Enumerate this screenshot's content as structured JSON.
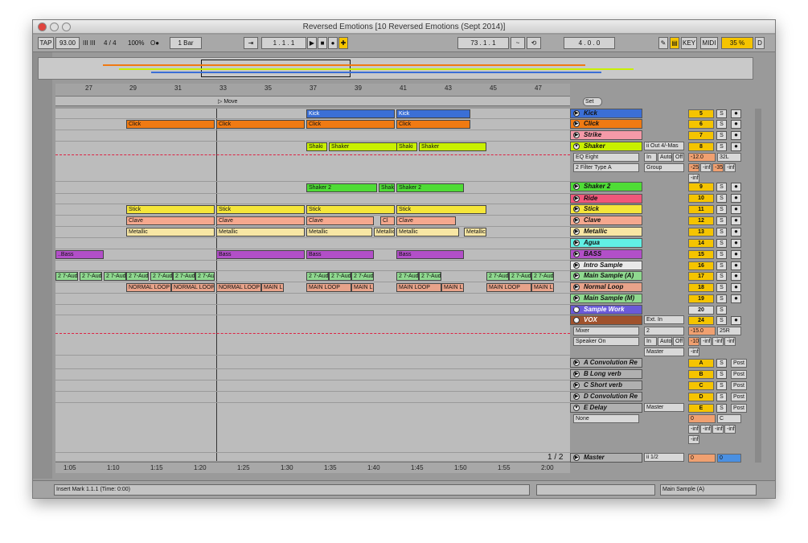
{
  "window": {
    "title": "Reversed Emotions  [10 Reversed Emotions (Sept 2014)]"
  },
  "toolbar": {
    "tap": "TAP",
    "tempo": "93.00",
    "nudge": "III  III",
    "signature": "4 / 4",
    "zoom": "100%",
    "metro": "O●",
    "quantize": "1 Bar",
    "follow": "⇥",
    "position": "1 .  1 .  1",
    "loop_start": "73 .  1 .  1",
    "loop_len": "4 .  0 .  0",
    "key": "KEY",
    "midi": "MIDI",
    "cpu": "35 %",
    "disk": "D"
  },
  "ruler": {
    "bars": [
      "27",
      "29",
      "31",
      "33",
      "35",
      "37",
      "39",
      "41",
      "43",
      "45",
      "47"
    ]
  },
  "locator": {
    "label": "Move"
  },
  "timebar": {
    "marks": [
      "1:05",
      "1:10",
      "1:15",
      "1:20",
      "1:25",
      "1:30",
      "1:35",
      "1:40",
      "1:45",
      "1:50",
      "1:55",
      "2:00"
    ]
  },
  "setbar": {
    "label": "Set"
  },
  "page": "1 / 2",
  "tracks": [
    {
      "name": "Kick",
      "num": "5",
      "color": "#3b6fd6"
    },
    {
      "name": "Click",
      "num": "6",
      "color": "#f07a12"
    },
    {
      "name": "Strike",
      "num": "7",
      "color": "#f59aa8"
    },
    {
      "name": "Shaker",
      "num": "8",
      "color": "#c8f000"
    },
    {
      "name": "Shaker 2",
      "num": "9",
      "color": "#4fdc36"
    },
    {
      "name": "Ride",
      "num": "10",
      "color": "#f0577a"
    },
    {
      "name": "Stick",
      "num": "11",
      "color": "#f5e63a"
    },
    {
      "name": "Clave",
      "num": "12",
      "color": "#f5a88e"
    },
    {
      "name": "Metallic",
      "num": "13",
      "color": "#f7e6a4"
    },
    {
      "name": "Agua",
      "num": "14",
      "color": "#61f0e4"
    },
    {
      "name": "BASS",
      "num": "15",
      "color": "#b24fc8"
    },
    {
      "name": "Intro Sample",
      "num": "16",
      "color": "#e8e8e8"
    },
    {
      "name": "Main Sample (A)",
      "num": "17",
      "color": "#8fd98f"
    },
    {
      "name": "Normal Loop",
      "num": "18",
      "color": "#e8a38a"
    },
    {
      "name": "Main Sample (M)",
      "num": "19",
      "color": "#8fd98f"
    },
    {
      "name": "Sample Work",
      "num": "20",
      "color": "#6a5ad8"
    },
    {
      "name": "VOX",
      "num": "24",
      "color": "#a0522d"
    }
  ],
  "returns": [
    {
      "name": "A Convolution Re",
      "letter": "A"
    },
    {
      "name": "B Long verb",
      "letter": "B"
    },
    {
      "name": "C Short verb",
      "letter": "C"
    },
    {
      "name": "D Convolution Re",
      "letter": "D"
    },
    {
      "name": "E Delay",
      "letter": "E"
    }
  ],
  "master": {
    "name": "Master",
    "route": "ii 1/2",
    "val": "0"
  },
  "shaker_io": {
    "out": "ii Out 4/-Mas",
    "device": "EQ Eight",
    "filter": "2 Filter Type A",
    "group": "Group",
    "vol": "-12.0",
    "pan": "32L",
    "in": "In",
    "auto": "Auto",
    "off": "Off",
    "v1": "-25",
    "v2": "-inf",
    "v3": "-35",
    "v4": "-inf",
    "v5": "-inf"
  },
  "vox_io": {
    "input": "Ext. In",
    "ch": "2",
    "mixer": "Mixer",
    "speaker": "Speaker On",
    "master": "Master",
    "vol": "-15.0",
    "pan": "25R",
    "in": "In",
    "auto": "Auto",
    "off": "Off",
    "v1": "-10",
    "v2": "-inf",
    "v3": "-inf",
    "v4": "-inf",
    "v5": "-inf"
  },
  "delay_io": {
    "none": "None",
    "master": "Master",
    "val": "0",
    "pan": "C",
    "v1": "-inf",
    "v2": "-inf",
    "v3": "-inf",
    "v4": "-inf",
    "v5": "-inf"
  },
  "solo": "S",
  "post": "Post",
  "status": {
    "text": "Insert Mark 1.1.1 (Time: 0:00)",
    "right": "Main Sample (A)"
  },
  "clips": {
    "kick": "Kick",
    "click": "Click",
    "shaker": "Shaker",
    "shaki": "Shaki",
    "shaker2": "Shaker 2",
    "shak": "Shak",
    "stick": "Stick",
    "clave": "Clave",
    "cl": "Cl",
    "metallic": "Metallic",
    "bass": "Bass",
    "bass2": "..Bass",
    "aud": "2 7-Aud",
    "normal": "NORMAL LOOP",
    "main": "MAIN LOOP",
    "mainl": "MAIN L"
  }
}
